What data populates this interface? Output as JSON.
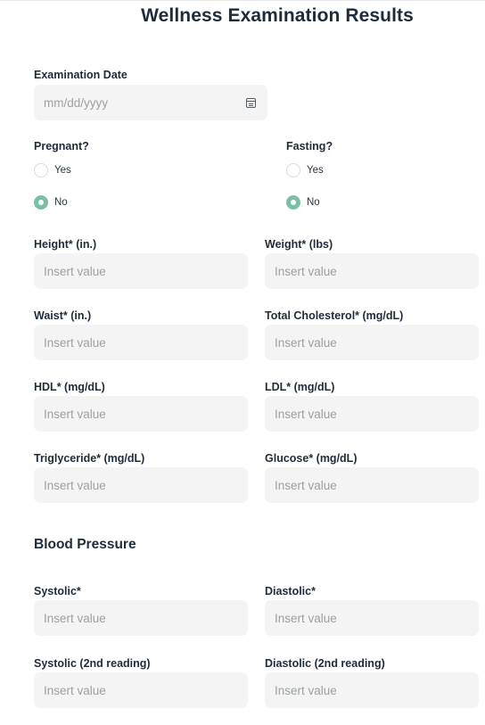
{
  "form": {
    "title": "Wellness Examination Results",
    "examination_date": {
      "label": "Examination Date",
      "placeholder": "mm/dd/yyyy"
    },
    "pregnant": {
      "label": "Pregnant?",
      "options": [
        "Yes",
        "No"
      ],
      "selected": "No"
    },
    "fasting": {
      "label": "Fasting?",
      "options": [
        "Yes",
        "No"
      ],
      "selected": "No"
    },
    "fields": {
      "height": {
        "label": "Height* (in.)",
        "placeholder": "Insert value"
      },
      "weight": {
        "label": "Weight* (lbs)",
        "placeholder": "Insert value"
      },
      "waist": {
        "label": "Waist* (in.)",
        "placeholder": "Insert value"
      },
      "total_cholesterol": {
        "label": "Total Cholesterol* (mg/dL)",
        "placeholder": "Insert value"
      },
      "hdl": {
        "label": "HDL* (mg/dL)",
        "placeholder": "Insert value"
      },
      "ldl": {
        "label": "LDL* (mg/dL)",
        "placeholder": "Insert value"
      },
      "triglyceride": {
        "label": "Triglyceride* (mg/dL)",
        "placeholder": "Insert value"
      },
      "glucose": {
        "label": "Glucose* (mg/dL)",
        "placeholder": "Insert value"
      }
    },
    "blood_pressure": {
      "heading": "Blood Pressure",
      "systolic": {
        "label": "Systolic*",
        "placeholder": "Insert value"
      },
      "diastolic": {
        "label": "Diastolic*",
        "placeholder": "Insert value"
      },
      "systolic_2": {
        "label": "Systolic (2nd reading)",
        "placeholder": "Insert value"
      },
      "diastolic_2": {
        "label": "Diastolic (2nd reading)",
        "placeholder": "Insert value"
      }
    }
  },
  "colors": {
    "accent_radio": "#7cc0a3",
    "field_background": "#f4f4f4",
    "heading_text": "#1e2b3a"
  }
}
